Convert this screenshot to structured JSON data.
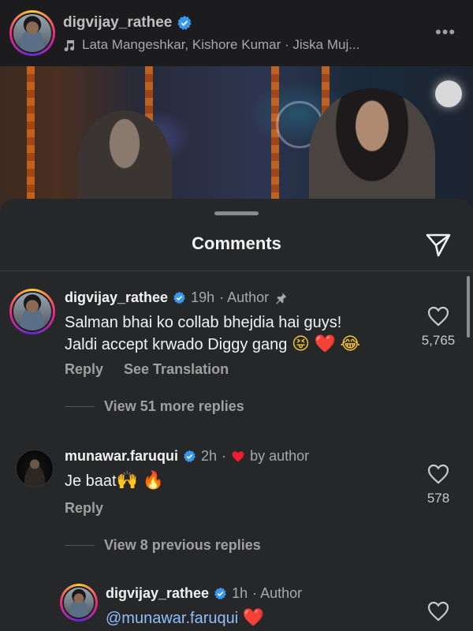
{
  "post": {
    "username": "digvijay_rathee",
    "music": "Lata Mangeshkar,  Kishore Kumar · Jiska Muj...",
    "more": "•••"
  },
  "sheet": {
    "title": "Comments"
  },
  "comments": [
    {
      "username": "digvijay_rathee",
      "time": "19h",
      "tag": "· Author",
      "line1": "Salman bhai ko collab bhejdia hai guys!",
      "line2": "Jaldi accept krwado Diggy gang",
      "emojis": [
        "😝",
        "❤️",
        "😂"
      ],
      "likes": "5,765",
      "reply_label": "Reply",
      "translate_label": "See Translation",
      "view_replies": "View 51 more replies"
    },
    {
      "username": "munawar.faruqui",
      "time": "2h",
      "tag": "by author",
      "text": "Je baat",
      "emojis": [
        "🙌",
        "🔥"
      ],
      "likes": "578",
      "reply_label": "Reply",
      "view_replies": "View 8 previous replies"
    },
    {
      "username": "digvijay_rathee",
      "time": "1h",
      "tag": "· Author",
      "mention": "@munawar.faruqui",
      "emojis": [
        "❤️"
      ]
    }
  ],
  "colors": {
    "sheet_bg": "#262729",
    "verified_blue": "#3897f0",
    "heart_red": "#ee1d33",
    "secondary_text": "#a8a8a8"
  },
  "icons": {
    "share": "paper-plane-icon",
    "like": "heart-outline-icon",
    "pin": "pin-icon",
    "music": "music-note-icon"
  }
}
